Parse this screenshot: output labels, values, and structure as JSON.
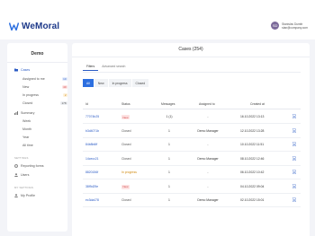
{
  "app": {
    "logo_text": "WeMoral"
  },
  "user": {
    "initials": "SD",
    "name": "Stanislav Dumitr",
    "email": "stan@company.com"
  },
  "sidebar": {
    "org_name": "Demo",
    "cases_label": "Cases",
    "case_items": [
      {
        "label": "Assigned to me",
        "count": "10"
      },
      {
        "label": "New",
        "count": "40"
      },
      {
        "label": "In progress",
        "count": "2"
      },
      {
        "label": "Closed",
        "count": "178"
      }
    ],
    "summary_label": "Summary",
    "summary_items": [
      {
        "label": "Week"
      },
      {
        "label": "Month"
      },
      {
        "label": "Year"
      },
      {
        "label": "All time"
      }
    ],
    "settings_section": "SETTINGS",
    "settings_items": [
      {
        "label": "Reporting forms"
      },
      {
        "label": "Users"
      }
    ],
    "my_settings_section": "MY SETTINGS",
    "my_settings_items": [
      {
        "label": "My Profile"
      }
    ]
  },
  "main": {
    "title": "Cases (254)",
    "tabs": [
      {
        "label": "Filters"
      },
      {
        "label": "Advanced search"
      }
    ],
    "filters": [
      {
        "label": "All"
      },
      {
        "label": "New"
      },
      {
        "label": "In progress"
      },
      {
        "label": "Closed"
      }
    ],
    "columns": {
      "id": "Id",
      "status": "Status",
      "messages": "Messages",
      "assigned": "Assigned to",
      "created": "Created at"
    },
    "rows": [
      {
        "id": "77074b25",
        "status": "New",
        "status_kind": "new",
        "messages": "1 (1)",
        "assigned": "-",
        "created": "16.10.2022 13:13"
      },
      {
        "id": "b3d4071b",
        "status": "Closed",
        "status_kind": "closed",
        "messages": "1",
        "assigned": "Demo Manager",
        "created": "12.10.2022 13:28"
      },
      {
        "id": "84b8b6ff",
        "status": "Closed",
        "status_kind": "closed",
        "messages": "1",
        "assigned": "-",
        "created": "10.10.2022 11:51"
      },
      {
        "id": "14cecc21",
        "status": "Closed",
        "status_kind": "closed",
        "messages": "1",
        "assigned": "Demo Manager",
        "created": "08.10.2022 12:46"
      },
      {
        "id": "8820156f",
        "status": "In progress",
        "status_kind": "prog",
        "messages": "1",
        "assigned": "-",
        "created": "06.10.2022 10:42"
      },
      {
        "id": "38f9d29e",
        "status": "New",
        "status_kind": "new",
        "messages": "1",
        "assigned": "-",
        "created": "04.10.2022 09:04"
      },
      {
        "id": "ec3da478",
        "status": "Closed",
        "status_kind": "closed",
        "messages": "1",
        "assigned": "Demo Manager",
        "created": "02.10.2022 15:01"
      }
    ]
  }
}
